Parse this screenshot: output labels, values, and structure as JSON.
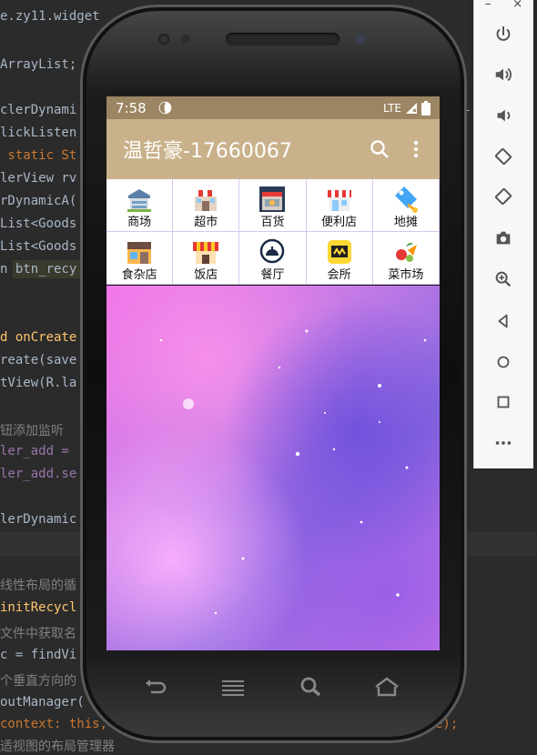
{
  "ide": {
    "code_lines": [
      "e.zy11.widget",
      "ArrayList;",
      "clerDynami",
      "lickListen",
      " static St",
      "lerView rv",
      "rDynamicA(",
      "List<Goods",
      "List<Goods",
      "n btn_recy",
      "d onCreate",
      "reate(save",
      "tView(R.la",
      "钮添加监听",
      "ler_add =",
      "ler_add.se",
      "lerDynamic",
      "线性布局的循",
      "initRecycl",
      "文件中获取名",
      "c = findVi",
      "个垂直方向的",
      "outManager(",
      "context: this,",
      "适视图的布局管理器"
    ],
    "right_fragments": [
      "i",
      "e);"
    ]
  },
  "emulator_panel": {
    "window_controls": [
      "–",
      "×"
    ],
    "buttons": [
      "power-icon",
      "volume-up-icon",
      "volume-down-icon",
      "rotate-left-icon",
      "rotate-right-icon",
      "camera-icon",
      "zoom-icon",
      "back-icon",
      "home-icon",
      "overview-icon",
      "more-icon"
    ]
  },
  "status_bar": {
    "time": "7:58",
    "network": "LTE",
    "color": "#9c8562"
  },
  "app_bar": {
    "title": "温哲豪-17660067",
    "color": "#c9b18b"
  },
  "categories": [
    {
      "label": "商场",
      "icon": "mall-icon"
    },
    {
      "label": "超市",
      "icon": "supermarket-icon"
    },
    {
      "label": "百货",
      "icon": "department-store-icon"
    },
    {
      "label": "便利店",
      "icon": "convenience-store-icon"
    },
    {
      "label": "地摊",
      "icon": "price-tag-icon"
    },
    {
      "label": "食杂店",
      "icon": "grocery-icon"
    },
    {
      "label": "饭店",
      "icon": "restaurant-icon"
    },
    {
      "label": "餐厅",
      "icon": "dining-icon"
    },
    {
      "label": "会所",
      "icon": "club-icon"
    },
    {
      "label": "菜市场",
      "icon": "vegetable-market-icon"
    }
  ]
}
